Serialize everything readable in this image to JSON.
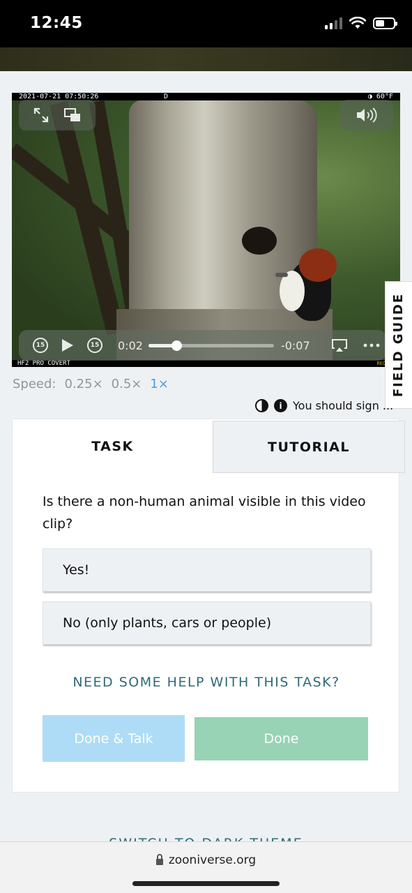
{
  "status_bar": {
    "time": "12:45"
  },
  "video": {
    "timestamp": "2021-07-21 07:50:26",
    "mode": "D",
    "temperature": "◑ 60°F",
    "camera_model": "HF2 PRO COVERT",
    "brand": "RECONYX",
    "current_time": "0:02",
    "remaining_time": "-0:07",
    "progress": 0.22,
    "skip_back_label": "15",
    "skip_forward_label": "15"
  },
  "field_guide": {
    "label": "FIELD GUIDE"
  },
  "speed": {
    "label": "Speed:",
    "options": [
      "0.25×",
      "0.5×",
      "1×"
    ],
    "selected": "1×"
  },
  "notice": {
    "text": "You should sign ...",
    "info_glyph": "i"
  },
  "tabs": {
    "task": "TASK",
    "tutorial": "TUTORIAL"
  },
  "task": {
    "question": "Is there a non-human animal visible in this video clip?",
    "answers": [
      "Yes!",
      "No (only plants, cars or people)"
    ],
    "help_link": "NEED SOME HELP WITH THIS TASK?",
    "done_talk": "Done & Talk",
    "done": "Done"
  },
  "footer": {
    "dark_theme": "SWITCH TO DARK THEME"
  },
  "browser": {
    "url": "zooniverse.org"
  },
  "colors": {
    "accent": "#4b9ed6",
    "link": "#2f6a77",
    "done_talk_bg": "#aedcf7",
    "done_bg": "#97d3b4",
    "panel_bg": "#eef1f4"
  }
}
